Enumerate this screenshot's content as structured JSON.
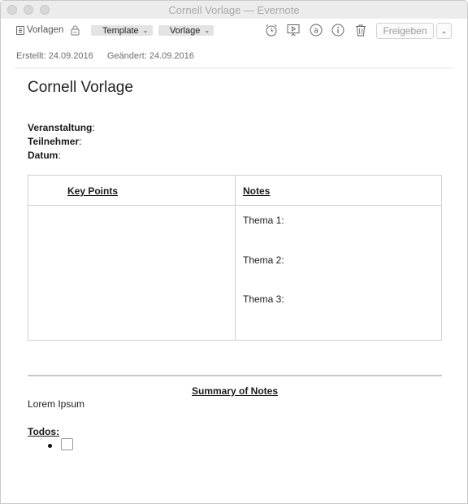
{
  "window": {
    "title": "Cornell Vorlage — Evernote"
  },
  "toolbar": {
    "notebook_label": "Vorlagen",
    "notebook_icon": "notebook-icon",
    "tags": [
      "Template",
      "Vorlage"
    ],
    "icons": [
      "reminder-alarm-icon",
      "presentation-icon",
      "work-chat-at-icon",
      "note-info-icon",
      "trash-icon"
    ],
    "share_label": "Freigeben"
  },
  "meta": {
    "created": "Erstellt: 24.09.2016",
    "modified": "Geändert: 24.09.2016"
  },
  "note": {
    "title": "Cornell Vorlage",
    "fields": [
      {
        "label": "Veranstaltung",
        "sep": ":"
      },
      {
        "label": "Teilnehmer",
        "sep": ":"
      },
      {
        "label": "Datum",
        "sep": ":"
      }
    ],
    "table": {
      "key_points_header": "Key Points",
      "notes_header": "Notes",
      "topics": [
        "Thema 1:",
        "Thema 2:",
        "Thema 3:"
      ]
    },
    "summary": {
      "header": "Summary of Notes",
      "body": "Lorem Ipsum"
    },
    "todos": {
      "header": "Todos:",
      "items": [
        {
          "checked": false,
          "text": ""
        }
      ]
    }
  }
}
